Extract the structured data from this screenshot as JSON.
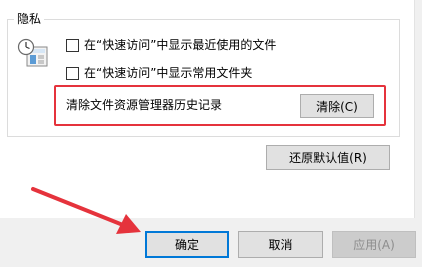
{
  "privacy": {
    "title": "隐私",
    "checkboxes": [
      {
        "label": "在“快速访问”中显示最近使用的文件",
        "checked": false
      },
      {
        "label": "在“快速访问”中显示常用文件夹",
        "checked": false
      }
    ],
    "clear_history_label": "清除文件资源管理器历史记录",
    "clear_button": "清除(C)",
    "icon": "privacy-settings-icon"
  },
  "restore_defaults_button": "还原默认值(R)",
  "dialog_buttons": {
    "ok": "确定",
    "cancel": "取消",
    "apply": "应用(A)"
  },
  "colors": {
    "highlight": "#e5333c",
    "annotation_arrow": "#e5333c",
    "default_button_border": "#0078d7"
  }
}
